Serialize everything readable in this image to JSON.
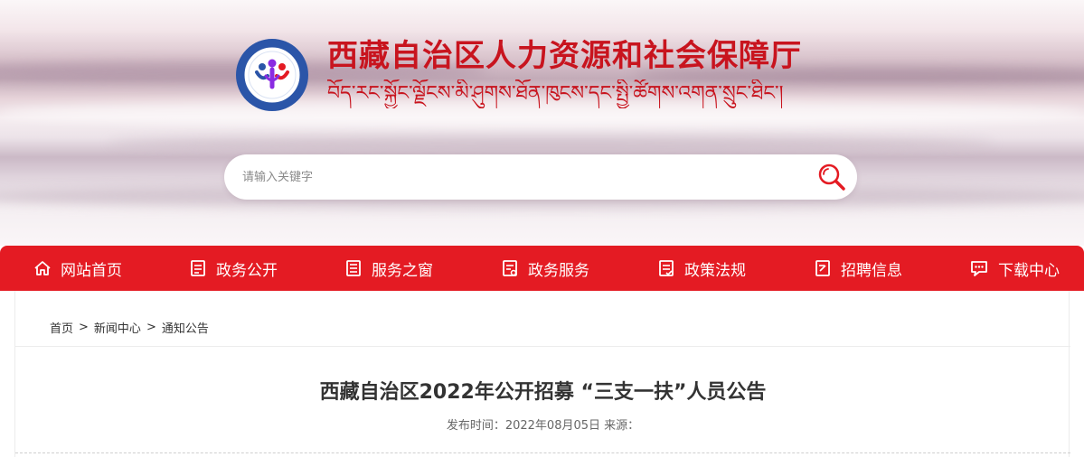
{
  "header": {
    "title": "西藏自治区人力资源和社会保障厅",
    "subtitle_tibetan": "བོད་རང་སྐྱོང་ལྗོངས་མི་ཤུགས་ཐོན་ཁུངས་དང་སྤྱི་ཚོགས་འགན་སྲུང་ཐིང་།",
    "logo_icon": "people-emblem-icon",
    "colors": {
      "brand_red": "#c8141e",
      "nav_red": "#e41b23",
      "logo_blue": "#2b55a8"
    }
  },
  "search": {
    "placeholder": "请输入关键字",
    "icon": "search-icon"
  },
  "nav": {
    "items": [
      {
        "label": "网站首页",
        "icon": "home-icon"
      },
      {
        "label": "政务公开",
        "icon": "document-icon"
      },
      {
        "label": "服务之窗",
        "icon": "window-doc-icon"
      },
      {
        "label": "政务服务",
        "icon": "service-doc-icon"
      },
      {
        "label": "政策法规",
        "icon": "policy-doc-icon"
      },
      {
        "label": "招聘信息",
        "icon": "recruit-doc-icon"
      },
      {
        "label": "下载中心",
        "icon": "chat-download-icon"
      }
    ]
  },
  "breadcrumb": {
    "items": [
      "首页",
      "新闻中心",
      "通知公告"
    ],
    "separator": ">"
  },
  "article": {
    "title": "西藏自治区2022年公开招募 “三支一扶”人员公告",
    "meta": "发布时间：2022年08月05日 来源："
  }
}
